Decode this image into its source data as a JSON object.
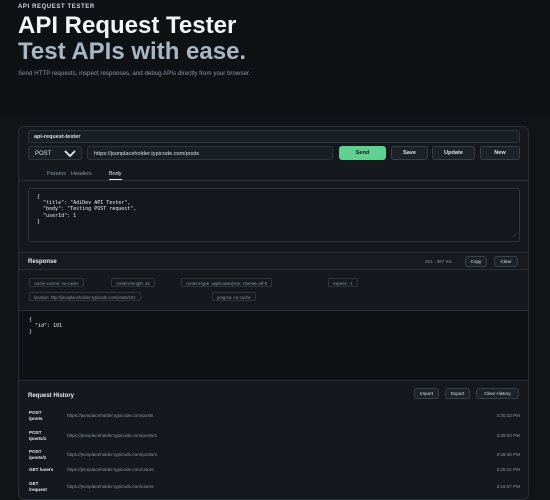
{
  "hero": {
    "eyebrow": "API REQUEST TESTER",
    "title_line1": "API Request Tester",
    "title_line2": "Test APIs with ease.",
    "subtitle": "Send HTTP requests, inspect responses, and debug APIs directly from your browser."
  },
  "request": {
    "name": "api-request-tester",
    "method": "POST",
    "url": "https://jsonplaceholder.typicode.com/posts",
    "buttons": {
      "send": "Send",
      "save": "Save",
      "update": "Update",
      "new": "New"
    },
    "tabs": [
      "Params",
      "Headers",
      "Body"
    ],
    "active_tab": "Body",
    "body_text": "{\n  \"title\": \"AdiDev API Tester\",\n  \"body\": \"Testing POST request\",\n  \"userId\": 1\n}"
  },
  "response": {
    "title": "Response",
    "status": "201 · 387 ms",
    "copy_label": "Copy",
    "clear_label": "Clear",
    "headers": [
      "cache-control: no-cache",
      "content-length: 15",
      "content-type: application/json; charset=utf-8",
      "expires: -1",
      "location: http://jsonplaceholder.typicode.com/posts/101",
      "pragma: no-cache"
    ],
    "body_text": "{\n  \"id\": 101\n}"
  },
  "history": {
    "title": "Request History",
    "import_label": "Import",
    "export_label": "Export",
    "clear_label": "Clear History",
    "items": [
      {
        "method": "POST",
        "path": "/posts",
        "url": "https://jsonplaceholder.typicode.com/posts",
        "time": "3:30:33 PM"
      },
      {
        "method": "POST",
        "path": "/posts/1",
        "url": "https://jsonplaceholder.typicode.com/posts/1",
        "time": "3:29:03 PM"
      },
      {
        "method": "POST",
        "path": "/posts/1",
        "url": "https://jsonplaceholder.typicode.com/posts/1",
        "time": "3:28:36 PM"
      },
      {
        "method": "GET",
        "path": "/users",
        "url": "https://jsonplaceholder.typicode.com/users",
        "time": "3:25:21 PM"
      },
      {
        "method": "GET",
        "path": "/request",
        "url": "https://jsonplaceholder.typicode.com/users",
        "time": "3:15:07 PM"
      }
    ]
  }
}
